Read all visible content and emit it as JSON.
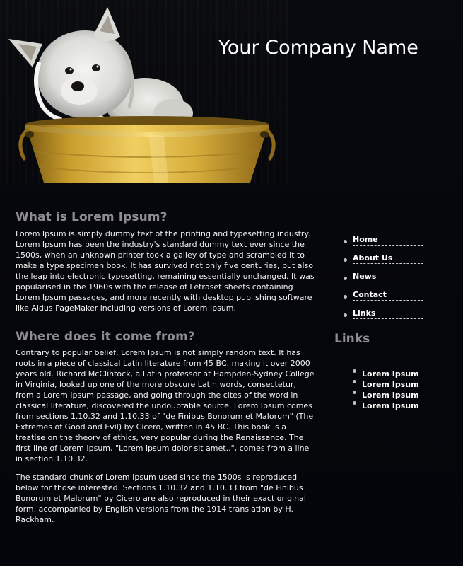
{
  "header": {
    "company_name": "Your Company Name",
    "hero_image": "west-highland-terrier-in-yellow-bucket"
  },
  "main": {
    "section1": {
      "title": "What is Lorem Ipsum?",
      "paragraph": "Lorem Ipsum is simply dummy text of the printing and typesetting industry. Lorem Ipsum has been the industry's standard dummy text ever since the 1500s, when an unknown printer took a galley of type and scrambled it to make a type specimen book. It has survived not only five centuries, but also the leap into electronic typesetting, remaining essentially unchanged. It was popularised in the 1960s with the release of Letraset sheets containing Lorem Ipsum passages, and more recently with desktop publishing software like Aldus PageMaker including versions of Lorem Ipsum."
    },
    "section2": {
      "title": "Where does it come from?",
      "paragraph1": "Contrary to popular belief, Lorem Ipsum is not simply random text. It has roots in a piece of classical Latin literature from 45 BC, making it over 2000 years old. Richard McClintock, a Latin professor at Hampden-Sydney College in Virginia, looked up one of the more obscure Latin words, consectetur, from a Lorem Ipsum passage, and going through the cites of the word in classical literature, discovered the undoubtable source. Lorem Ipsum comes from sections 1.10.32 and 1.10.33 of \"de Finibus Bonorum et Malorum\" (The Extremes of Good and Evil) by Cicero, written in 45 BC. This book is a treatise on the theory of ethics, very popular during the Renaissance. The first line of Lorem Ipsum, \"Lorem ipsum dolor sit amet..\", comes from a line in section 1.10.32.",
      "paragraph2": "The standard chunk of Lorem Ipsum used since the 1500s is reproduced below for those interested. Sections 1.10.32 and 1.10.33 from \"de Finibus Bonorum et Malorum\" by Cicero are also reproduced in their exact original form, accompanied by English versions from the 1914 translation by H. Rackham."
    }
  },
  "sidebar": {
    "nav": [
      {
        "label": "Home"
      },
      {
        "label": "About Us"
      },
      {
        "label": "News"
      },
      {
        "label": "Contact"
      },
      {
        "label": "Links"
      }
    ],
    "links_title": "Links",
    "links": [
      {
        "label": "Lorem Ipsum"
      },
      {
        "label": "Lorem Ipsum"
      },
      {
        "label": "Lorem Ipsum"
      },
      {
        "label": "Lorem Ipsum"
      }
    ]
  },
  "colors": {
    "background": "#05070d",
    "heading": "#8d8d93",
    "text": "#f2f2f2",
    "bucket_yellow": "#d4ad3e"
  }
}
